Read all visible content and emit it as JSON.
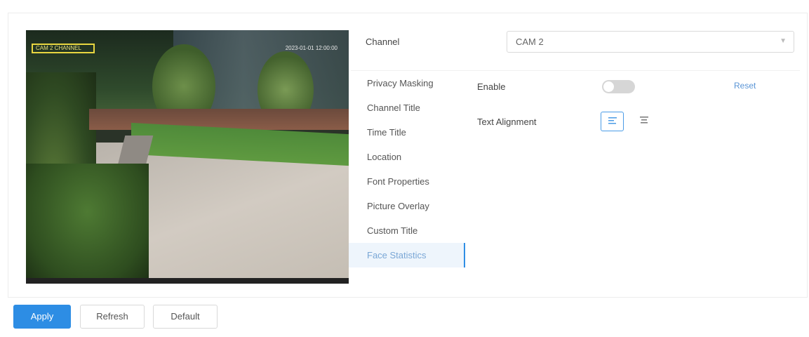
{
  "video": {
    "osd_channel_title": "CAM 2 CHANNEL",
    "osd_time_title": "2023-01-01 12:00:00"
  },
  "channel": {
    "label": "Channel",
    "value": "CAM 2"
  },
  "menu": {
    "items": [
      {
        "label": "Privacy Masking"
      },
      {
        "label": "Channel Title"
      },
      {
        "label": "Time Title"
      },
      {
        "label": "Location"
      },
      {
        "label": "Font Properties"
      },
      {
        "label": "Picture Overlay"
      },
      {
        "label": "Custom Title"
      },
      {
        "label": "Face Statistics"
      }
    ],
    "active_index": 7
  },
  "settings": {
    "enable_label": "Enable",
    "enable_on": false,
    "reset_label": "Reset",
    "text_alignment_label": "Text Alignment",
    "alignment_selected": "left"
  },
  "icons": {
    "align_left": "align-left-icon",
    "align_center": "align-center-icon",
    "chevron": "chevron-down-icon"
  },
  "colors": {
    "accent": "#2d8de4",
    "active_menu_bg": "#eef5fc",
    "toggle_off": "#d6d6d6"
  },
  "footer": {
    "apply_label": "Apply",
    "refresh_label": "Refresh",
    "default_label": "Default"
  }
}
